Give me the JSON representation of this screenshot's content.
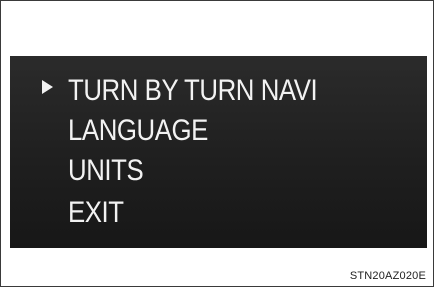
{
  "menu": {
    "items": [
      {
        "label": "TURN BY TURN NAVI",
        "selected": true
      },
      {
        "label": "LANGUAGE",
        "selected": false
      },
      {
        "label": "UNITS",
        "selected": false
      },
      {
        "label": "EXIT",
        "selected": false
      }
    ],
    "cursor_icon": "triangle-right-icon"
  },
  "figure_code": "STN20AZ020E",
  "colors": {
    "screen_background": "#1f1f1f",
    "menu_text": "#f2f2f2",
    "page_background": "#ffffff"
  }
}
